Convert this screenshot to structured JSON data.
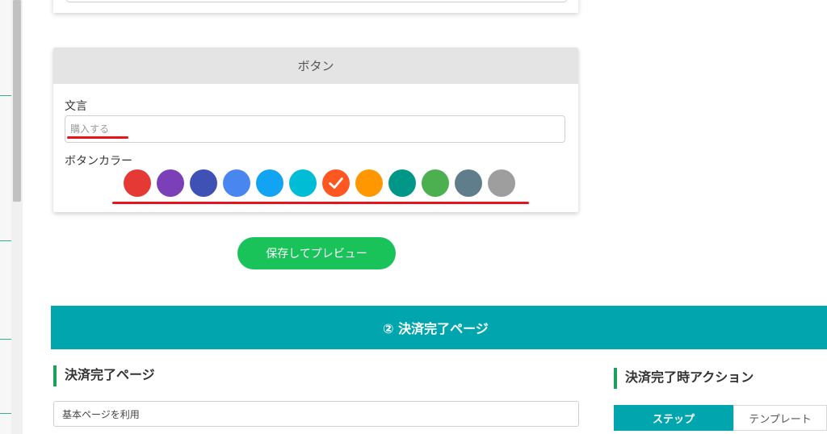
{
  "button_card": {
    "title": "ボタン",
    "wording_label": "文言",
    "wording_placeholder": "購入する",
    "color_label": "ボタンカラー",
    "colors": [
      {
        "hex": "#e53935",
        "selected": false
      },
      {
        "hex": "#7b3fb7",
        "selected": false
      },
      {
        "hex": "#3f51b5",
        "selected": false
      },
      {
        "hex": "#4a86f0",
        "selected": false
      },
      {
        "hex": "#12a4f2",
        "selected": false
      },
      {
        "hex": "#00bcd4",
        "selected": false
      },
      {
        "hex": "#ff5722",
        "selected": true
      },
      {
        "hex": "#ff9800",
        "selected": false
      },
      {
        "hex": "#009688",
        "selected": false
      },
      {
        "hex": "#4caf50",
        "selected": false
      },
      {
        "hex": "#607d8b",
        "selected": false
      },
      {
        "hex": "#9e9e9e",
        "selected": false
      }
    ]
  },
  "save_button_label": "保存してプレビュー",
  "section_banner": "② 決済完了ページ",
  "completion_page": {
    "heading": "決済完了ページ",
    "select_value": "基本ページを利用"
  },
  "completion_action": {
    "heading": "決済完了時アクション",
    "tabs": [
      {
        "label": "ステップ",
        "active": true
      },
      {
        "label": "テンプレート",
        "active": false
      }
    ]
  },
  "colors": {
    "accent_green": "#19c35a",
    "banner_teal": "#00a5ae",
    "annotation_red": "#e8141c"
  }
}
